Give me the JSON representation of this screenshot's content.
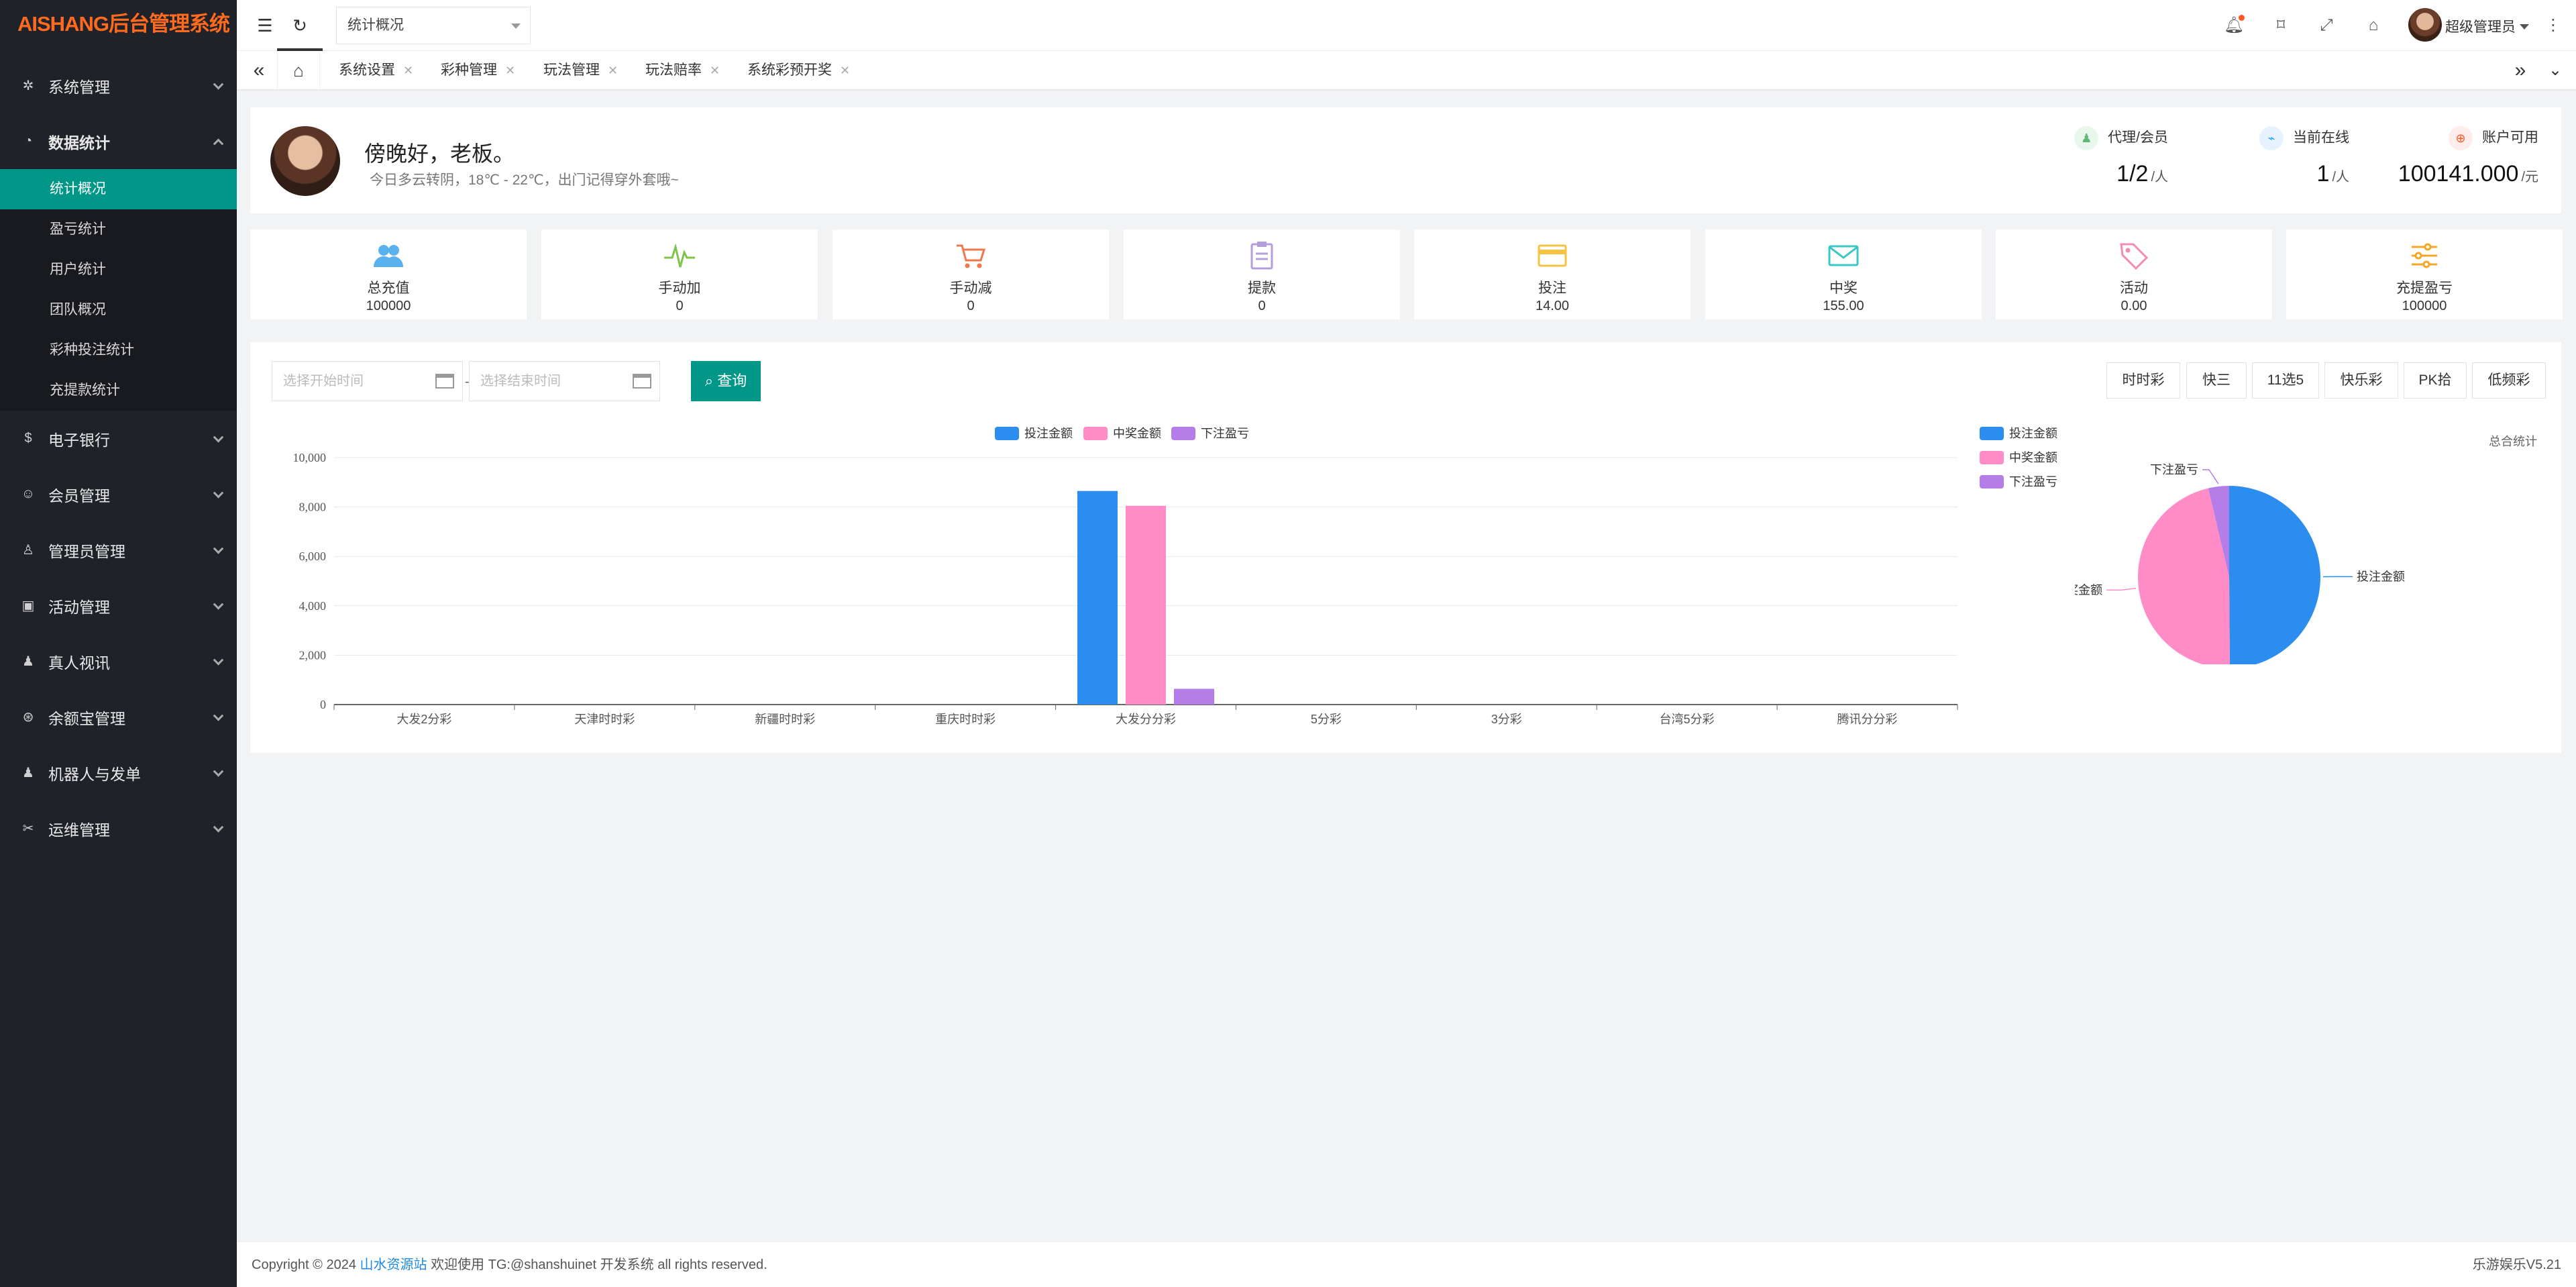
{
  "brand": {
    "logo_text": "AISHANG后台管理系统"
  },
  "sidebar": {
    "items": [
      {
        "label": "系统管理",
        "icon": "gear-icon"
      },
      {
        "label": "数据统计",
        "icon": "dashboard-icon"
      },
      {
        "label": "电子银行",
        "icon": "dollar-icon"
      },
      {
        "label": "会员管理",
        "icon": "user-icon"
      },
      {
        "label": "管理员管理",
        "icon": "admin-icon"
      },
      {
        "label": "活动管理",
        "icon": "gift-icon"
      },
      {
        "label": "真人视讯",
        "icon": "users-icon"
      },
      {
        "label": "余额宝管理",
        "icon": "wallet-icon"
      },
      {
        "label": "机器人与发单",
        "icon": "robot-icon"
      },
      {
        "label": "运维管理",
        "icon": "tools-icon"
      }
    ],
    "sub_items": [
      "统计概况",
      "盈亏统计",
      "用户统计",
      "团队概况",
      "彩种投注统计",
      "充提款统计"
    ]
  },
  "topbar": {
    "select_value": "统计概况",
    "user_name": "超级管理员"
  },
  "tabs": [
    "系统设置",
    "彩种管理",
    "玩法管理",
    "玩法赔率",
    "系统彩预开奖"
  ],
  "greeting": {
    "title": "傍晚好，老板。",
    "subtitle": "今日多云转阴，18℃ - 22℃，出门记得穿外套哦~"
  },
  "top_stats": [
    {
      "label": "代理/会员",
      "value": "1/2",
      "unit": "/人",
      "color": "#5fb878"
    },
    {
      "label": "当前在线",
      "value": "1",
      "unit": "/人",
      "color": "#1e9fff"
    },
    {
      "label": "账户可用",
      "value": "100141.000",
      "unit": "/元",
      "color": "#ff5722"
    }
  ],
  "cards": [
    {
      "label": "总充值",
      "value": "100000",
      "icon": "users-icon",
      "color": "#5ab1ef"
    },
    {
      "label": "手动加",
      "value": "0",
      "icon": "pulse-icon",
      "color": "#7ec34a"
    },
    {
      "label": "手动减",
      "value": "0",
      "icon": "cart-icon",
      "color": "#f0784c"
    },
    {
      "label": "提款",
      "value": "0",
      "icon": "clipboard-icon",
      "color": "#b39ddb"
    },
    {
      "label": "投注",
      "value": "14.00",
      "icon": "card-icon",
      "color": "#f5c242"
    },
    {
      "label": "中奖",
      "value": "155.00",
      "icon": "mail-icon",
      "color": "#3cc7c7"
    },
    {
      "label": "活动",
      "value": "0.00",
      "icon": "tag-icon",
      "color": "#f28cb1"
    },
    {
      "label": "充提盈亏",
      "value": "100000",
      "icon": "sliders-icon",
      "color": "#f5a623"
    }
  ],
  "filters": {
    "start_placeholder": "选择开始时间",
    "end_placeholder": "选择结束时间",
    "query_label": "查询",
    "lottery_buttons": [
      "时时彩",
      "快三",
      "11选5",
      "快乐彩",
      "PK拾",
      "低频彩"
    ]
  },
  "chart_data": [
    {
      "type": "bar",
      "categories": [
        "大发2分彩",
        "天津时时彩",
        "新疆时时彩",
        "重庆时时彩",
        "大发分分彩",
        "5分彩",
        "3分彩",
        "台湾5分彩",
        "腾讯分分彩"
      ],
      "series": [
        {
          "name": "投注金额",
          "color": "#2b8ded",
          "values": [
            0,
            0,
            0,
            0,
            8650,
            0,
            0,
            0,
            0
          ]
        },
        {
          "name": "中奖金额",
          "color": "#ff8cc6",
          "values": [
            0,
            0,
            0,
            0,
            8050,
            0,
            0,
            0,
            0
          ]
        },
        {
          "name": "下注盈亏",
          "color": "#b57de8",
          "values": [
            0,
            0,
            0,
            0,
            640,
            0,
            0,
            0,
            0
          ]
        }
      ],
      "ylim": [
        0,
        10000
      ],
      "yticks": [
        "0",
        "2,000",
        "4,000",
        "6,000",
        "8,000",
        "10,000"
      ],
      "legend": "top"
    },
    {
      "type": "pie",
      "title": "总合统计",
      "slices": [
        {
          "name": "投注金额",
          "value": 8650,
          "color": "#2b8ded"
        },
        {
          "name": "中奖金额",
          "value": 8050,
          "color": "#ff8cc6"
        },
        {
          "name": "下注盈亏",
          "value": 640,
          "color": "#b57de8"
        }
      ],
      "legend": "left"
    }
  ],
  "footer": {
    "prefix": "Copyright © 2024",
    "link": "山水资源站",
    "suffix": "欢迎使用 TG:@shanshuinet 开发系统 all rights reserved.",
    "version": "乐游娱乐V5.21"
  }
}
